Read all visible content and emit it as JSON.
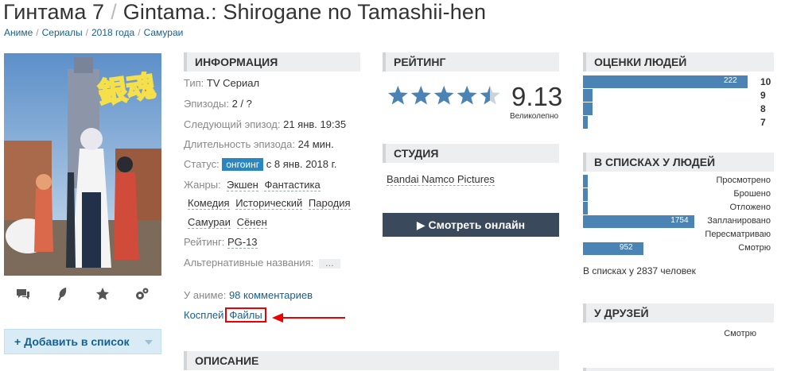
{
  "title": {
    "ru": "Гинтама 7",
    "sep": "/",
    "en": "Gintama.: Shirogane no Tamashii-hen"
  },
  "breadcrumbs": [
    "Аниме",
    "Сериалы",
    "2018 года",
    "Самураи"
  ],
  "breadcrumb_sep": "/",
  "poster": {
    "kanji": "銀魂"
  },
  "actions": {
    "add_label": "Добавить в список"
  },
  "info": {
    "heading": "ИНФОРМАЦИЯ",
    "type_label": "Тип:",
    "type_value": "TV Сериал",
    "episodes_label": "Эпизоды:",
    "episodes_value": "2 / ?",
    "next_label": "Следующий эпизод:",
    "next_value": "21 янв. 19:35",
    "duration_label": "Длительность эпизода:",
    "duration_value": "24 мин.",
    "status_label": "Статус:",
    "status_badge": "онгоинг",
    "status_value": "с 8 янв. 2018 г.",
    "genres_label": "Жанры:",
    "genres": [
      "Экшен",
      "Фантастика",
      "Комедия",
      "Исторический",
      "Пародия",
      "Самураи",
      "Сёнен"
    ],
    "rating_label": "Рейтинг:",
    "rating_value": "PG-13",
    "alt_label": "Альтернативные названия:",
    "alt_more": "…"
  },
  "links": {
    "comments_prefix": "У аниме:",
    "comments": "98 комментариев",
    "cosplay": "Косплей",
    "files": "Файлы"
  },
  "description": {
    "heading": "ОПИСАНИЕ"
  },
  "rating": {
    "heading": "РЕЙТИНГ",
    "score": "9.13",
    "word": "Великолепно",
    "stars": 4.5
  },
  "studio": {
    "heading": "СТУДИЯ",
    "name": "Bandai Namco Pictures"
  },
  "watch": {
    "label": "Смотреть онлайн"
  },
  "people_scores": {
    "heading": "ОЦЕНКИ ЛЮДЕЙ",
    "rows": [
      {
        "score": "10",
        "count": "222",
        "fraction": 1.0
      },
      {
        "score": "9",
        "count": "",
        "fraction": 0.06
      },
      {
        "score": "8",
        "count": "",
        "fraction": 0.06
      },
      {
        "score": "7",
        "count": "",
        "fraction": 0.03
      }
    ]
  },
  "people_lists": {
    "heading": "В СПИСКАХ У ЛЮДЕЙ",
    "rows": [
      {
        "label": "Просмотрено",
        "count": "",
        "fraction": 0.01
      },
      {
        "label": "Брошено",
        "count": "",
        "fraction": 0.01
      },
      {
        "label": "Отложено",
        "count": "",
        "fraction": 0.01
      },
      {
        "label": "Запланировано",
        "count": "1754",
        "fraction": 0.61
      },
      {
        "label": "Пересматриваю",
        "count": "",
        "fraction": 0.0
      },
      {
        "label": "Смотрю",
        "count": "952",
        "fraction": 0.33
      }
    ],
    "total": "В списках у 2837 человек"
  },
  "friends": {
    "heading": "У ДРУЗЕЙ",
    "item": "Смотрю"
  },
  "colors": {
    "accent": "#2a86c1",
    "bar": "#4c83b5",
    "watch_button": "#3a4a5c",
    "highlight": "#e00000"
  }
}
